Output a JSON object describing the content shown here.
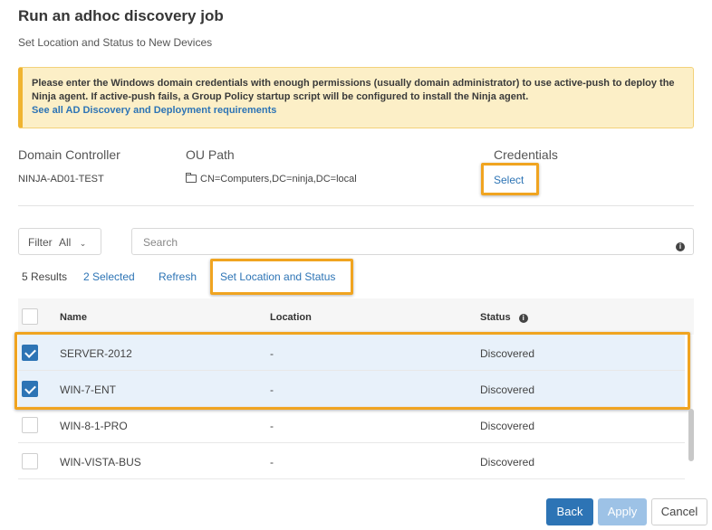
{
  "page": {
    "title": "Run an adhoc discovery job",
    "subtitle": "Set Location and Status to New Devices"
  },
  "alert": {
    "text": "Please enter the Windows domain credentials with enough permissions (usually domain administrator) to use active-push to deploy the Ninja agent. If active-push fails, a Group Policy startup script will be configured to install the Ninja agent.",
    "link": "See all AD Discovery and Deployment requirements",
    "colors": {
      "background": "#fcefc7",
      "border": "#f0b430"
    }
  },
  "domain_info": {
    "domain_controller_label": "Domain Controller",
    "domain_controller_value": "NINJA-AD01-TEST",
    "ou_path_label": "OU Path",
    "ou_path_value": "CN=Computers,DC=ninja,DC=local",
    "credentials_label": "Credentials",
    "credentials_action": "Select"
  },
  "filter": {
    "label": "Filter",
    "value": "All",
    "search_placeholder": "Search"
  },
  "results": {
    "count": "5 Results",
    "selected": "2 Selected",
    "refresh": "Refresh",
    "set_location_status": "Set Location and Status"
  },
  "table": {
    "columns": [
      "Name",
      "Location",
      "Status"
    ],
    "rows": [
      {
        "name": "SERVER-2012",
        "location": "-",
        "status": "Discovered",
        "checked": true
      },
      {
        "name": "WIN-7-ENT",
        "location": "-",
        "status": "Discovered",
        "checked": true
      },
      {
        "name": "WIN-8-1-PRO",
        "location": "-",
        "status": "Discovered",
        "checked": false
      },
      {
        "name": "WIN-VISTA-BUS",
        "location": "-",
        "status": "Discovered",
        "checked": false
      }
    ]
  },
  "buttons": {
    "back": "Back",
    "apply": "Apply",
    "cancel": "Cancel"
  },
  "colors": {
    "accent": "#2d74b5",
    "highlight": "#f0a420",
    "selected_row": "#e8f1fa"
  }
}
